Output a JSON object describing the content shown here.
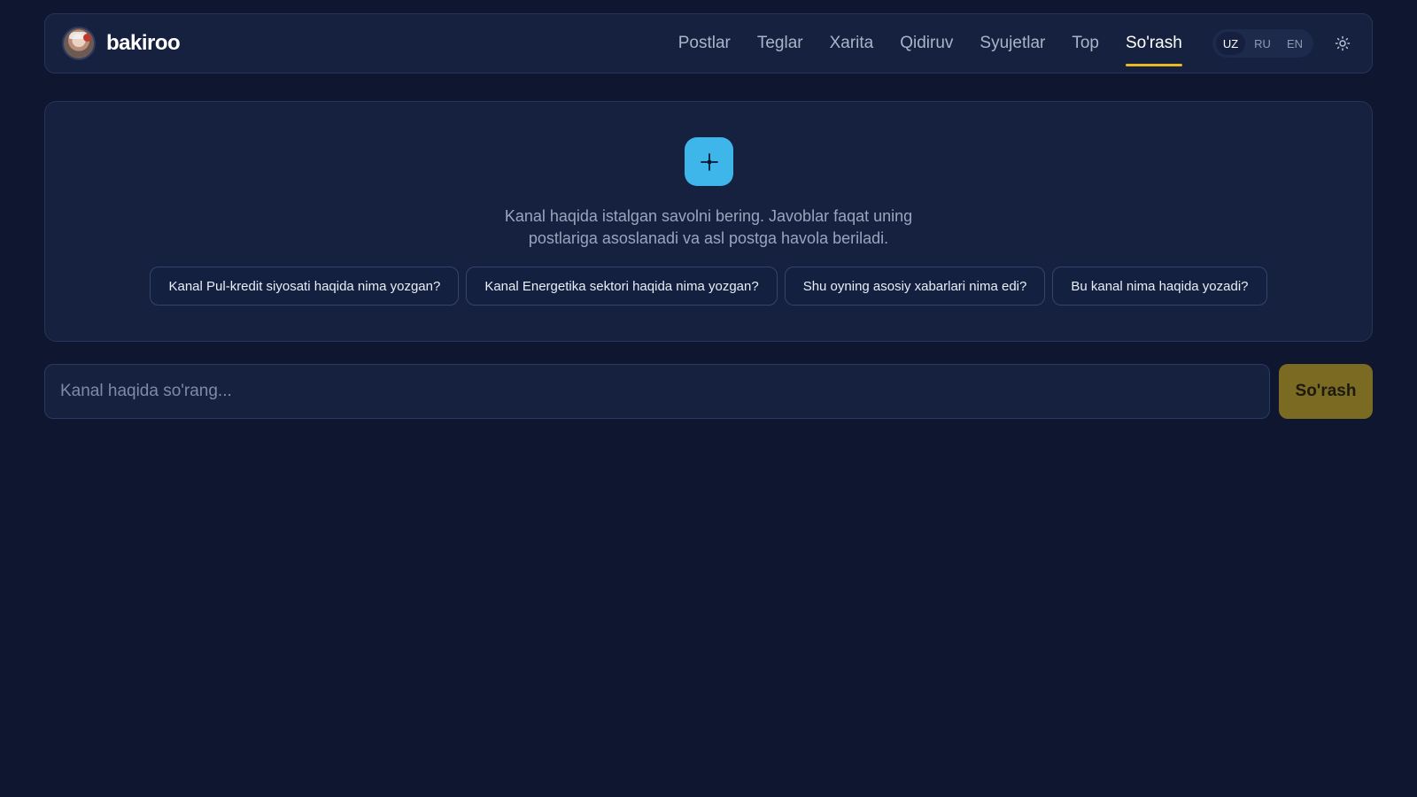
{
  "header": {
    "brand_name": "bakiroo",
    "nav": [
      {
        "label": "Postlar"
      },
      {
        "label": "Teglar"
      },
      {
        "label": "Xarita"
      },
      {
        "label": "Qidiruv"
      },
      {
        "label": "Syujetlar"
      },
      {
        "label": "Top"
      },
      {
        "label": "So'rash",
        "active": true
      }
    ],
    "languages": [
      {
        "label": "UZ",
        "active": true
      },
      {
        "label": "RU"
      },
      {
        "label": "EN"
      }
    ],
    "theme_icon": "sun-icon"
  },
  "panel": {
    "icon": "sparkle-icon",
    "intro_line1": "Kanal haqida istalgan savolni bering. Javoblar faqat uning",
    "intro_line2": "postlariga asoslanadi va asl postga havola beriladi.",
    "suggestions": [
      "Kanal Pul-kredit siyosati haqida nima yozgan?",
      "Kanal Energetika sektori haqida nima yozgan?",
      "Shu oyning asosiy xabarlari nima edi?",
      "Bu kanal nima haqida yozadi?"
    ]
  },
  "ask": {
    "placeholder": "Kanal haqida so'rang...",
    "value": "",
    "button_label": "So'rash"
  },
  "colors": {
    "background": "#0e1630",
    "accent": "#e8b923",
    "sparkle": "#3fb6ea",
    "ask_button": "#7a6a22"
  }
}
